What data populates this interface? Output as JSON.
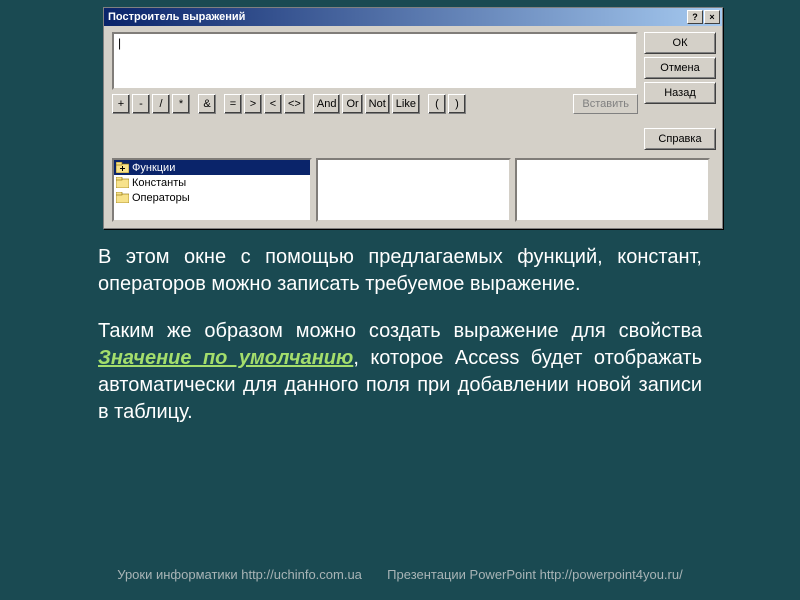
{
  "window": {
    "title": "Построитель выражений",
    "help_btn": "?",
    "close_btn": "×",
    "expression_value": "|",
    "operators": [
      "+",
      "-",
      "/",
      "*",
      "&",
      "=",
      ">",
      "<",
      "<>",
      "And",
      "Or",
      "Not",
      "Like",
      "(",
      ")"
    ],
    "insert_label": "Вставить",
    "side_buttons": {
      "ok": "ОК",
      "cancel": "Отмена",
      "back": "Назад",
      "help": "Справка"
    },
    "tree": {
      "functions": "Функции",
      "constants": "Константы",
      "operators": "Операторы"
    }
  },
  "text": {
    "p1": "В этом окне с помощью предлагаемых функций, констант, операторов можно записать требуемое выражение.",
    "p2a": "Таким же образом можно создать выражение для свойства ",
    "p2_hl": "Значение по умолчанию",
    "p2b": ", которое Access будет отображать автоматически для данного поля при добавлении новой записи в таблицу."
  },
  "footer": {
    "left": "Уроки информатики  http://uchinfo.com.ua",
    "right": "Презентации PowerPoint  http://powerpoint4you.ru/"
  }
}
